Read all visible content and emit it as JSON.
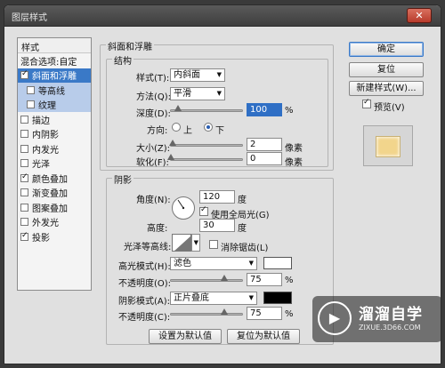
{
  "window": {
    "title": "图层样式",
    "close_glyph": "✕"
  },
  "stylelist": {
    "header": "样式",
    "items": [
      {
        "label": "混合选项:自定",
        "check": false,
        "has_box": false,
        "state": "normal"
      },
      {
        "label": "斜面和浮雕",
        "check": true,
        "has_box": true,
        "state": "selected"
      },
      {
        "label": "等高线",
        "check": false,
        "has_box": true,
        "state": "sub"
      },
      {
        "label": "纹理",
        "check": false,
        "has_box": true,
        "state": "sub"
      },
      {
        "label": "描边",
        "check": false,
        "has_box": true,
        "state": "normal"
      },
      {
        "label": "内阴影",
        "check": false,
        "has_box": true,
        "state": "normal"
      },
      {
        "label": "内发光",
        "check": false,
        "has_box": true,
        "state": "normal"
      },
      {
        "label": "光泽",
        "check": false,
        "has_box": true,
        "state": "normal"
      },
      {
        "label": "颜色叠加",
        "check": true,
        "has_box": true,
        "state": "normal"
      },
      {
        "label": "渐变叠加",
        "check": false,
        "has_box": true,
        "state": "normal"
      },
      {
        "label": "图案叠加",
        "check": false,
        "has_box": true,
        "state": "normal"
      },
      {
        "label": "外发光",
        "check": false,
        "has_box": true,
        "state": "normal"
      },
      {
        "label": "投影",
        "check": true,
        "has_box": true,
        "state": "normal"
      }
    ]
  },
  "bevel": {
    "section_title": "斜面和浮雕",
    "structure_title": "结构",
    "style_label": "样式(T):",
    "style_value": "内斜面",
    "technique_label": "方法(Q):",
    "technique_value": "平滑",
    "depth_label": "深度(D):",
    "depth_value": "100",
    "depth_unit": "%",
    "depth_fraction": 0.1,
    "direction_label": "方向:",
    "dir_up": "上",
    "dir_down": "下",
    "direction_selected": "下",
    "size_label": "大小(Z):",
    "size_value": "2",
    "size_unit": "像素",
    "size_fraction": 0.02,
    "soften_label": "软化(F):",
    "soften_value": "0",
    "soften_unit": "像素",
    "soften_fraction": 0.0
  },
  "shading": {
    "title": "阴影",
    "angle_label": "角度(N):",
    "angle_value": "120",
    "angle_unit": "度",
    "global_light_label": "使用全局光(G)",
    "global_light": true,
    "altitude_label": "高度:",
    "altitude_value": "30",
    "altitude_unit": "度",
    "gloss_label": "光泽等高线:",
    "antialias_label": "消除锯齿(L)",
    "antialias": false,
    "highlight_mode_label": "高光模式(H):",
    "highlight_mode_value": "滤色",
    "highlight_color": "#ffffff",
    "highlight_opacity_label": "不透明度(O):",
    "highlight_opacity_value": "75",
    "highlight_opacity_unit": "%",
    "highlight_opacity_fraction": 0.75,
    "shadow_mode_label": "阴影模式(A):",
    "shadow_mode_value": "正片叠底",
    "shadow_color": "#000000",
    "shadow_opacity_label": "不透明度(C):",
    "shadow_opacity_value": "75",
    "shadow_opacity_unit": "%",
    "shadow_opacity_fraction": 0.75
  },
  "footer": {
    "make_default": "设置为默认值",
    "reset_default": "复位为默认值"
  },
  "side": {
    "ok": "确定",
    "reset": "复位",
    "new_style": "新建样式(W)...",
    "preview_label": "预览(V)",
    "preview": true,
    "preview_color": "#f2d58c"
  },
  "watermark": {
    "logo_glyph": "▶",
    "text": "溜溜自学",
    "url": "ZIXUE.3D66.COM"
  }
}
